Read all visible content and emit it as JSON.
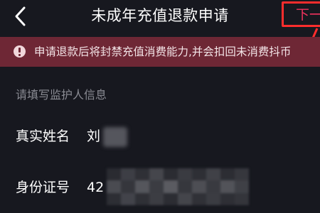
{
  "header": {
    "back_icon": "chevron-left-icon",
    "title": "未成年充值退款申请",
    "next_label": "下一"
  },
  "warning": {
    "icon": "exclamation-circle-icon",
    "text": "申请退款后将封禁充值消费能力,并会扣回未消费抖币"
  },
  "section": {
    "title": "请填写监护人信息"
  },
  "fields": [
    {
      "label": "真实姓名",
      "value": "刘"
    },
    {
      "label": "身份证号",
      "value": "42"
    }
  ],
  "colors": {
    "background": "#17181f",
    "banner": "#6e2735",
    "accent": "#f2335e",
    "highlight_box": "#ff2d2d",
    "muted_text": "#8a8b93"
  }
}
